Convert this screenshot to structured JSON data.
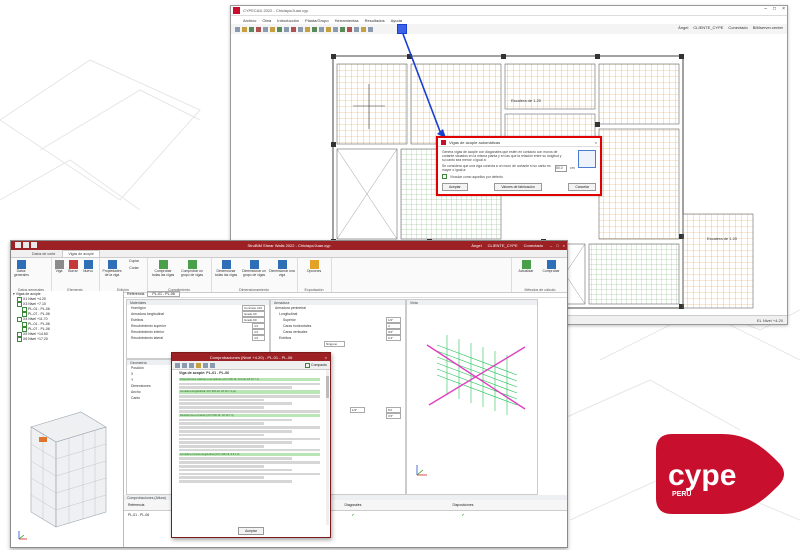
{
  "cypecad": {
    "title": "CYPECAD 2022 - Chiclayo/Juan.cyp",
    "menu": [
      "Archivo",
      "Edición",
      "Ver",
      "Ayuda"
    ],
    "menu_full": [
      "Archivo",
      "Obra",
      "Introducción",
      "Planta/Grupo",
      "Herramientas",
      "Resultados",
      "Ayuda"
    ],
    "toolbar_right": [
      "Ángel",
      "CLIENTE_CYPE",
      "Conectado",
      "BIMserver.center"
    ],
    "status": "1 - El Nivel +4.20",
    "status_right": "EL Nivel +4.20",
    "plan_labels": {
      "level1": "Escalera de 1.20",
      "level2": "Escalera de 1.20"
    }
  },
  "dialog": {
    "title": "Vigas de acople automáticas",
    "text": "Genera vigas de acople con diagonales que estén en contacto con muros de cortante situados en la misma planta y en las que la relación entre su longitud y su canto sea menor o igual a:",
    "label": "Se considera que una viga conecta a un muro de cortante si su canto es mayor o igual a:",
    "value": "4",
    "value2": "50.0",
    "unit": "cm",
    "checkbox": "Vincular como aquellos por defecto",
    "buttons": [
      "Aceptar",
      "Valores de fabricación",
      "Cancelar"
    ]
  },
  "shearwalls": {
    "title": "StruBIM Shear Walls 2022 - Chiclayo/Juan.cyp",
    "right": [
      "Ángel",
      "CLIENTE_CYPE",
      "Conectado"
    ],
    "tabs": [
      "Datos de corte",
      "Vigas de acople"
    ],
    "ribbon": {
      "groups": [
        "Datos generales",
        "Elemento",
        "Edición",
        "Cumplimiento",
        "Dimensionamiento",
        "Exportación",
        "Métodos de cálculo"
      ],
      "items": [
        "Datos generales",
        "Viga",
        "Borrar",
        "Nuevo",
        "Propiedades de la viga",
        "Copiar",
        "Cortar",
        "Comprobar todas las vigas",
        "Comprobar un grupo de vigas",
        "Dimensionar todas las vigas",
        "Dimensionar un grupo de vigas",
        "Dimensionar una viga",
        "Opciones",
        "Actualizar",
        "Comprobar"
      ]
    },
    "tree": [
      "Vigas de acople",
      "X1 Nivel +4.20",
      "X3 Nivel +7.10",
      "PL-01 - PL-06",
      "PL-07 - PL-06",
      "X4 Nivel +11.70",
      "PL-01 - PL-06",
      "PL-07 - PL-06",
      "X5 Nivel +14.60",
      "X6 Nivel +17.20"
    ],
    "reference": {
      "label": "Referencia",
      "value": "PL-01 - PL-06"
    },
    "materials": {
      "header": "Materiales",
      "rows": [
        {
          "label": "Hormigón",
          "value": "Concreto 210"
        },
        {
          "label": "Armadura longitudinal",
          "value": "Grado 60"
        },
        {
          "label": "Estribos",
          "value": "Grado 60"
        },
        {
          "label": "Recubrimiento superior",
          "value": "4.0"
        },
        {
          "label": "Recubrimiento inferior",
          "value": "4.0"
        },
        {
          "label": "Recubrimiento lateral",
          "value": "4.0"
        }
      ]
    },
    "geometry": {
      "header": "Geometría",
      "rows": [
        "Posición",
        "X",
        "Y",
        "Dimensiones",
        "Ancho",
        "Canto"
      ]
    },
    "armaduras": {
      "header": "Armadura",
      "rows": [
        "Armadura perimetral",
        "Longitudinal",
        "Superior",
        "Caras horizontales",
        "Caras verticales",
        "Estribos",
        "Ninguno"
      ],
      "values": [
        "1/2\"",
        "4",
        "3/4\"",
        "0.3\"",
        "1/2\"",
        "8.0",
        "3.5\""
      ]
    },
    "bottom_table": {
      "header": "Comprobaciones (Altura)",
      "cols": [
        "Referencia",
        "Armadura perimetral",
        "Diagonales",
        "Disposiciones"
      ],
      "row": "PL-01 - PL-06"
    }
  },
  "computation": {
    "title": "Comprobaciones (Nivel +4.20) - PL-01 - PL-06",
    "toolbar_right": "Compacto",
    "heading": "Viga de acople: PL-01 - PL-06",
    "lines": [
      "Disposiciones relativas a armaduras (ACI 318-19, Artículo 18.10.7.1)",
      "Armadura longitudinal: ACI 318-19, 18.10.7.4 (a)",
      "Resistencia a cortante (ACI 318-19, 18.10.7.4)",
      "Armadura mínima longitudinal (ACI 318-19, 9.6.1.2)"
    ],
    "button": "Aceptar"
  },
  "logo": {
    "brand": "cype",
    "sub": "PERÚ",
    "color": "#c8102e"
  }
}
